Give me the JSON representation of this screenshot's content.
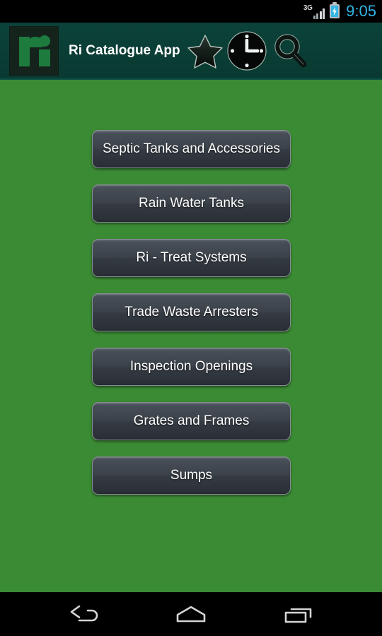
{
  "status_bar": {
    "network_label": "3G",
    "signal_icon": "signal-bars-icon",
    "battery_icon": "battery-charging-icon",
    "time": "9:05",
    "time_color": "#33b5e5"
  },
  "action_bar": {
    "logo_icon": "ri-logo-icon",
    "title": "Ri Catalogue App",
    "background_color": "#0b4239",
    "icons": [
      {
        "name": "star-icon",
        "label": "Favourites"
      },
      {
        "name": "clock-icon",
        "label": "History"
      },
      {
        "name": "search-icon",
        "label": "Search"
      }
    ]
  },
  "content": {
    "background_color": "#3b8b34",
    "menu_buttons": [
      {
        "label": "Septic Tanks and Accessories"
      },
      {
        "label": "Rain Water Tanks"
      },
      {
        "label": "Ri - Treat Systems"
      },
      {
        "label": "Trade Waste Arresters"
      },
      {
        "label": "Inspection Openings"
      },
      {
        "label": "Grates and Frames"
      },
      {
        "label": "Sumps"
      }
    ]
  },
  "nav_bar": {
    "background_color": "#000000",
    "buttons": [
      {
        "name": "back-icon",
        "label": "Back"
      },
      {
        "name": "home-icon",
        "label": "Home"
      },
      {
        "name": "recents-icon",
        "label": "Recent apps"
      }
    ]
  }
}
